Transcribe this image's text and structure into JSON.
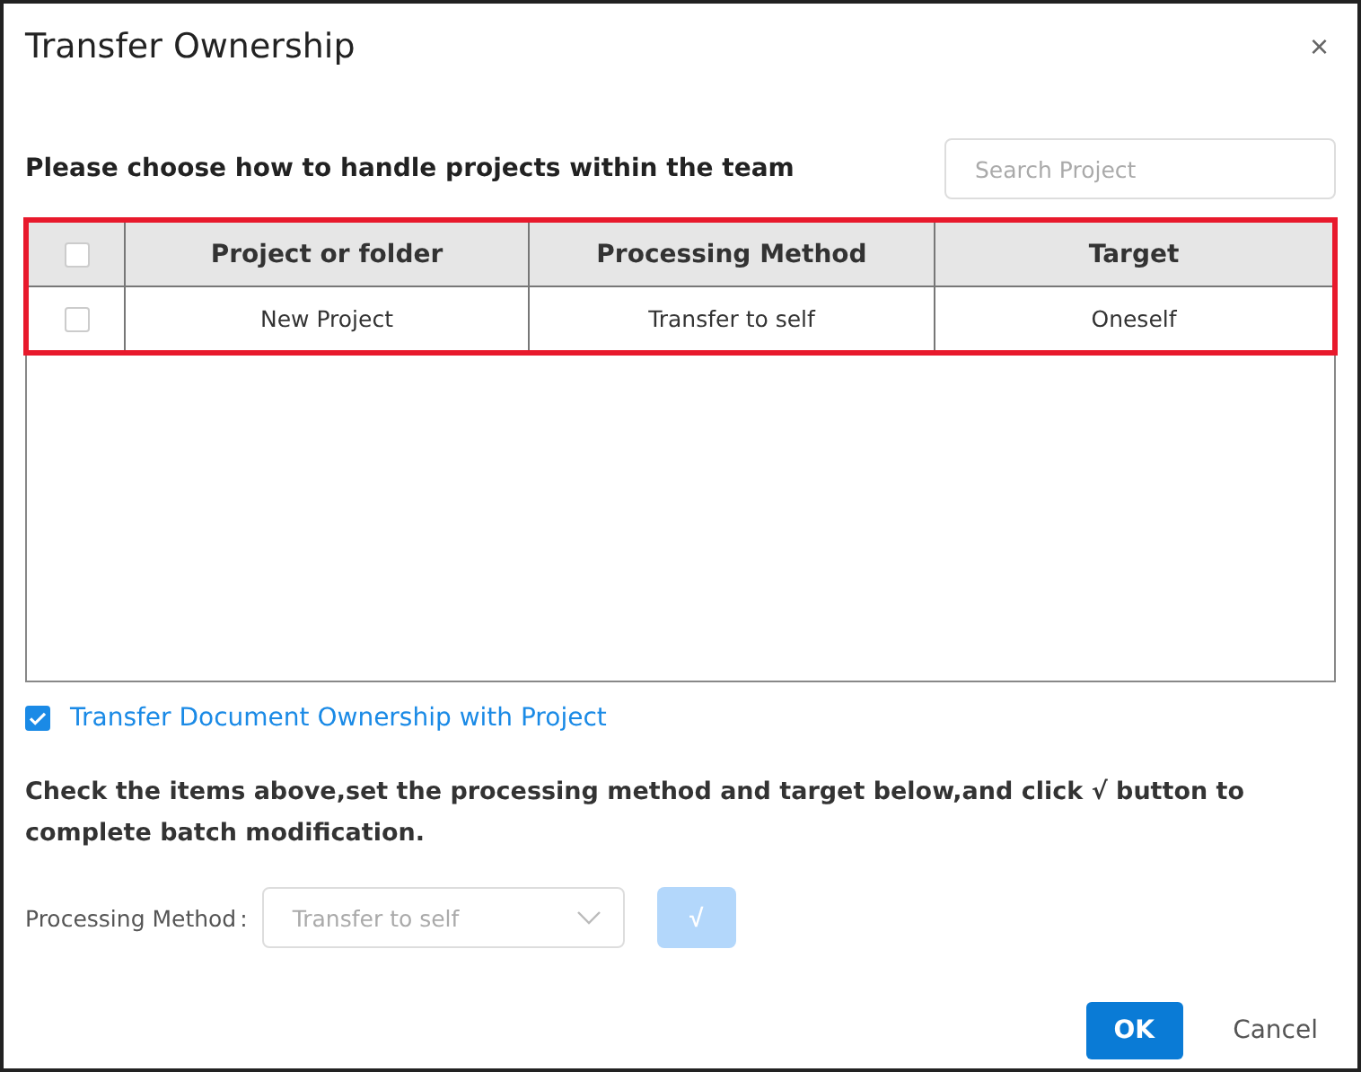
{
  "dialog": {
    "title": "Transfer Ownership",
    "close": "×"
  },
  "heading": "Please choose how to handle projects within the team",
  "search": {
    "placeholder": "Search Project"
  },
  "table": {
    "highlighted": true,
    "select_all": {
      "checked": false
    },
    "columns": [
      "Project or folder",
      "Processing Method",
      "Target"
    ],
    "rows": [
      {
        "checked": false,
        "cells": [
          "New Project",
          "Transfer to self",
          "Oneself"
        ]
      }
    ]
  },
  "transfer_docs": {
    "label": "Transfer Document Ownership with Project",
    "checked": true
  },
  "instruction": "Check the items above,set the processing method and target below,and click √ button to complete batch modification.",
  "batch": {
    "label": "Processing Method",
    "separator": ":",
    "value": "Transfer to self",
    "apply": "√",
    "apply_disabled": true
  },
  "buttons": {
    "ok": "OK",
    "cancel": "Cancel"
  }
}
